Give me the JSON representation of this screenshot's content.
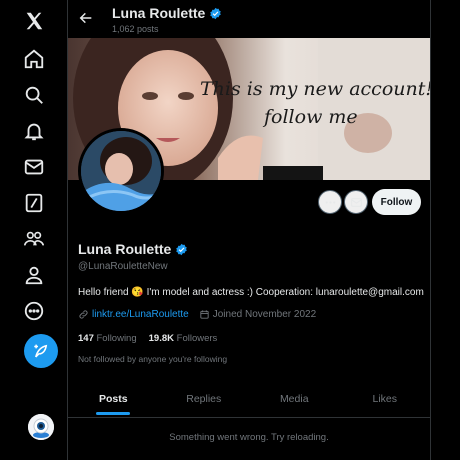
{
  "nav": {
    "items": [
      {
        "name": "x-logo-icon"
      },
      {
        "name": "home-icon"
      },
      {
        "name": "search-icon"
      },
      {
        "name": "notifications-icon"
      },
      {
        "name": "messages-icon"
      },
      {
        "name": "grok-icon"
      },
      {
        "name": "communities-icon"
      },
      {
        "name": "profile-icon"
      },
      {
        "name": "more-icon"
      }
    ],
    "compose_icon": "feather-plus-icon"
  },
  "topbar": {
    "name": "Luna Roulette",
    "post_count": "1,062 posts"
  },
  "banner": {
    "line1": "This is my new account!",
    "line2": "follow me"
  },
  "actions": {
    "follow_label": "Follow"
  },
  "profile": {
    "name": "Luna Roulette",
    "handle": "@LunaRouletteNew",
    "bio": "Hello friend 😘 I'm model and actress :) Cooperation: lunaroulette@gmail.com",
    "link": "linktr.ee/LunaRoulette",
    "joined": "Joined November 2022",
    "following_count": "147",
    "following_label": "Following",
    "followers_count": "19.8K",
    "followers_label": "Followers",
    "follow_note": "Not followed by anyone you're following"
  },
  "tabs": [
    {
      "label": "Posts",
      "active": true
    },
    {
      "label": "Replies",
      "active": false
    },
    {
      "label": "Media",
      "active": false
    },
    {
      "label": "Likes",
      "active": false
    }
  ],
  "timeline": {
    "error": "Something went wrong. Try reloading."
  },
  "colors": {
    "accent": "#1d9bf0",
    "background": "#000000",
    "text": "#e7e9ea",
    "muted": "#71767b",
    "border": "#2f3336"
  }
}
